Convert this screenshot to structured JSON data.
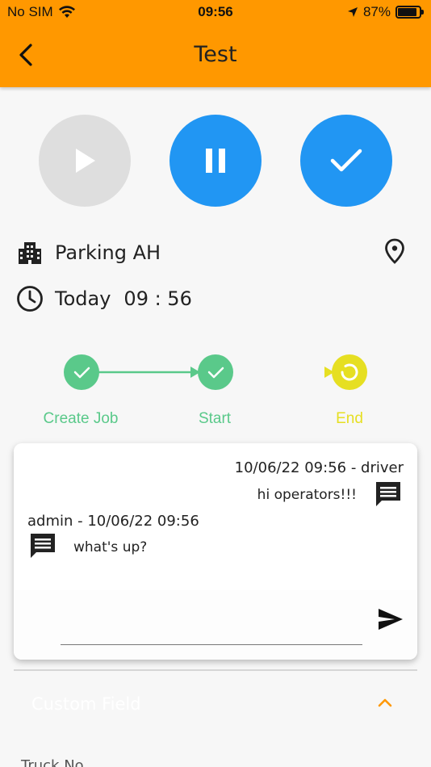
{
  "status_bar": {
    "carrier": "No SIM",
    "time": "09:56",
    "battery": "87%"
  },
  "header": {
    "title": "Test"
  },
  "controls": {
    "play_icon": "play-icon",
    "pause_icon": "pause-icon",
    "done_icon": "check-icon"
  },
  "info": {
    "location": "Parking AH",
    "time_day": "Today",
    "time_value": "09 : 56"
  },
  "stepper": {
    "steps": [
      {
        "label": "Create Job",
        "state": "done",
        "color": "#5ac98a"
      },
      {
        "label": "Start",
        "state": "done",
        "color": "#5ac98a"
      },
      {
        "label": "End",
        "state": "active",
        "color": "#e6df22"
      }
    ]
  },
  "chat": {
    "messages": [
      {
        "meta": "10/06/22 09:56 - driver",
        "text": "hi operators!!!",
        "side": "right"
      },
      {
        "meta": "admin - 10/06/22 09:56",
        "text": "what's up?",
        "side": "left"
      }
    ],
    "input_placeholder": ""
  },
  "custom_field": {
    "title": "Custom Field"
  },
  "truck_no": {
    "label": "Truck No"
  },
  "colors": {
    "accent": "#ff9800",
    "primary": "#2196f3",
    "success": "#5ac98a",
    "active": "#e6df22"
  }
}
